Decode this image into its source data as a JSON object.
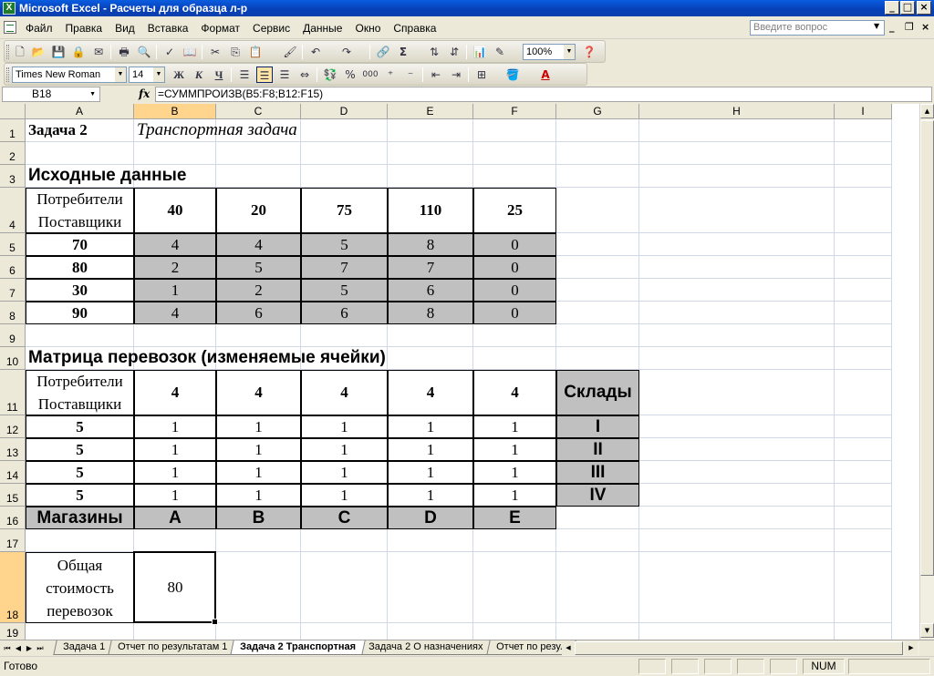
{
  "window": {
    "title": "Microsoft Excel - Расчеты для образца л-р",
    "app_icon": "excel-icon",
    "controls": [
      "_",
      "□",
      "×"
    ]
  },
  "menu": {
    "items": [
      "Файл",
      "Правка",
      "Вид",
      "Вставка",
      "Формат",
      "Сервис",
      "Данные",
      "Окно",
      "Справка"
    ],
    "help_placeholder": "Введите вопрос"
  },
  "toolbar": {
    "zoom": "100%",
    "font_name": "Times New Roman",
    "font_size": "14",
    "bold_label": "Ж",
    "italic_label": "К",
    "underline_label": "Ч",
    "percent_label": "%",
    "thousands_label": "000"
  },
  "formula_bar": {
    "name_box": "B18",
    "fx_label": "fx",
    "formula": "=СУММПРОИЗВ(B5:F8;B12:F15)"
  },
  "sheet": {
    "columns": [
      "A",
      "B",
      "C",
      "D",
      "E",
      "F",
      "G",
      "H",
      "I"
    ],
    "rows": [
      "1",
      "2",
      "3",
      "4",
      "5",
      "6",
      "7",
      "8",
      "9",
      "10",
      "11",
      "12",
      "13",
      "14",
      "15",
      "16",
      "17",
      "18",
      "19"
    ],
    "a1": "Задача 2",
    "b1": "Транспортная задача",
    "a3": "Исходные данные",
    "consumers_label": "Потребители",
    "suppliers_label": "Поставщики",
    "demand": [
      "40",
      "20",
      "75",
      "110",
      "25"
    ],
    "supply": [
      "70",
      "80",
      "30",
      "90"
    ],
    "costs": [
      [
        "4",
        "4",
        "5",
        "8",
        "0"
      ],
      [
        "2",
        "5",
        "7",
        "7",
        "0"
      ],
      [
        "1",
        "2",
        "5",
        "6",
        "0"
      ],
      [
        "4",
        "6",
        "6",
        "8",
        "0"
      ]
    ],
    "a10": "Матрица перевозок (изменяемые ячейки)",
    "matrix_demand": [
      "4",
      "4",
      "4",
      "4",
      "4"
    ],
    "matrix_supply": [
      "5",
      "5",
      "5",
      "5"
    ],
    "matrix": [
      [
        "1",
        "1",
        "1",
        "1",
        "1"
      ],
      [
        "1",
        "1",
        "1",
        "1",
        "1"
      ],
      [
        "1",
        "1",
        "1",
        "1",
        "1"
      ],
      [
        "1",
        "1",
        "1",
        "1",
        "1"
      ]
    ],
    "warehouses_label": "Склады",
    "warehouses": [
      "I",
      "II",
      "III",
      "IV"
    ],
    "shops_label": "Магазины",
    "shops": [
      "A",
      "B",
      "C",
      "D",
      "E"
    ],
    "total_label": [
      "Общая",
      "стоимость",
      "перевозок"
    ],
    "total_value": "80"
  },
  "tabs": {
    "items": [
      "Задача 1",
      "Отчет по результатам 1",
      "Задача 2 Транспортная",
      "Задача 2 О назначениях",
      "Отчет по резул"
    ],
    "active_index": 2
  },
  "status": {
    "ready": "Готово",
    "num": "NUM"
  }
}
